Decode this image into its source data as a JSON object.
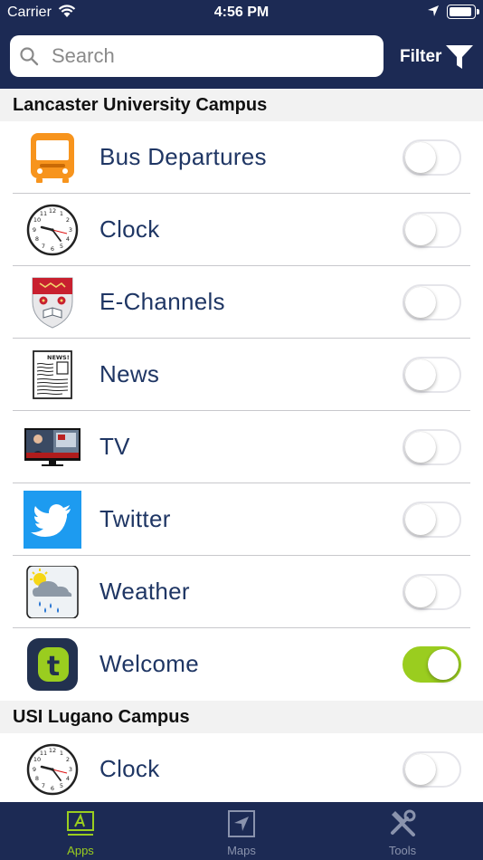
{
  "status_bar": {
    "carrier": "Carrier",
    "time": "4:56 PM",
    "battery_level": 0.95
  },
  "search": {
    "placeholder": "Search",
    "value": ""
  },
  "filter": {
    "label": "Filter",
    "icon": "filter-funnel-icon"
  },
  "sections": [
    {
      "title": "Lancaster University Campus",
      "items": [
        {
          "label": "Bus Departures",
          "icon": "bus-icon",
          "enabled": false
        },
        {
          "label": "Clock",
          "icon": "clock-icon",
          "enabled": false
        },
        {
          "label": "E-Channels",
          "icon": "crest-shield-icon",
          "enabled": false
        },
        {
          "label": "News",
          "icon": "newspaper-icon",
          "enabled": false
        },
        {
          "label": "TV",
          "icon": "tv-icon",
          "enabled": false
        },
        {
          "label": "Twitter",
          "icon": "twitter-bird-icon",
          "enabled": false
        },
        {
          "label": "Weather",
          "icon": "weather-rain-icon",
          "enabled": false
        },
        {
          "label": "Welcome",
          "icon": "welcome-t-icon",
          "enabled": true
        }
      ]
    },
    {
      "title": "USI Lugano Campus",
      "items": [
        {
          "label": "Clock",
          "icon": "clock-icon",
          "enabled": false
        }
      ]
    }
  ],
  "crest_text": {
    "news_word": "NEWS!",
    "welcome_letter": "t"
  },
  "tabs": [
    {
      "label": "Apps",
      "icon": "apps-icon",
      "active": true
    },
    {
      "label": "Maps",
      "icon": "maps-arrow-icon",
      "active": false
    },
    {
      "label": "Tools",
      "icon": "tools-wrench-screwdriver-icon",
      "active": false
    }
  ],
  "colors": {
    "nav_bar": "#1c2a54",
    "accent_active_tab": "#9acd1f",
    "inactive_tab": "#8a93ad",
    "toggle_on": "#9acd1f",
    "item_label": "#1f3664",
    "section_bg": "#f2f2f2"
  }
}
